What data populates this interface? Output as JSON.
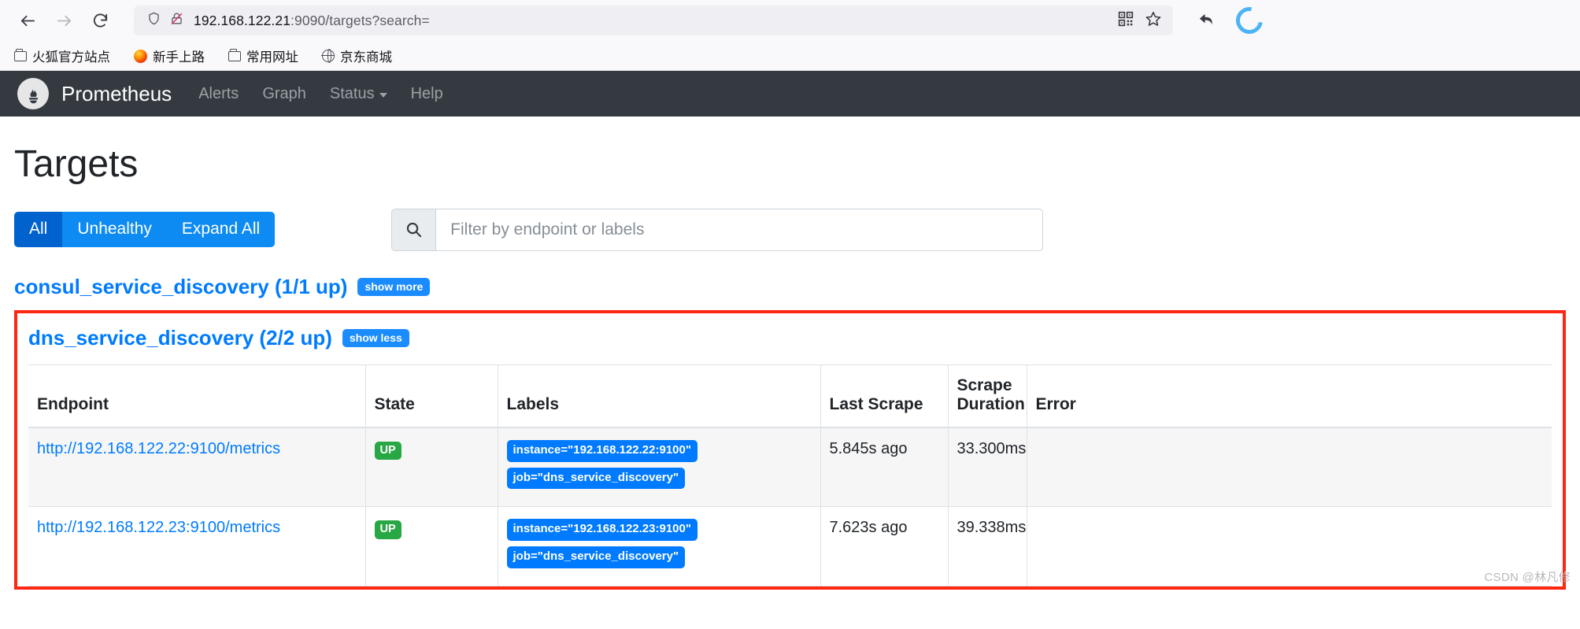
{
  "browser": {
    "back_label": "back-arrow",
    "forward_label": "forward-arrow",
    "reload_label": "reload",
    "url_host": "192.168.122.21",
    "url_rest": ":9090/targets?search=",
    "url_full": "192.168.122.21:9090/targets?search=",
    "shield_icon": "shield-icon",
    "permissions_icon": "no-lock-icon",
    "qr_icon": "qr-code-icon",
    "bookmark_icon": "star-icon",
    "undo_icon": "undo-arrow-icon",
    "sync_icon": "sync-circle-icon",
    "bookmarks": [
      {
        "label": "火狐官方站点",
        "icon": "folder-icon"
      },
      {
        "label": "新手上路",
        "icon": "firefox-icon"
      },
      {
        "label": "常用网址",
        "icon": "folder-icon"
      },
      {
        "label": "京东商城",
        "icon": "globe-icon"
      }
    ]
  },
  "navbar": {
    "logo_icon": "prometheus-torch-icon",
    "brand": "Prometheus",
    "links": [
      {
        "label": "Alerts",
        "dropdown": false
      },
      {
        "label": "Graph",
        "dropdown": false
      },
      {
        "label": "Status",
        "dropdown": true
      },
      {
        "label": "Help",
        "dropdown": false
      }
    ]
  },
  "page": {
    "title": "Targets",
    "filter_buttons": [
      {
        "label": "All",
        "active": true
      },
      {
        "label": "Unhealthy",
        "active": false
      },
      {
        "label": "Expand All",
        "active": false
      }
    ],
    "search": {
      "icon": "search-icon",
      "value": "",
      "placeholder": "Filter by endpoint or labels"
    },
    "watermark": "CSDN @林凡修"
  },
  "pools": [
    {
      "title": "consul_service_discovery (1/1 up)",
      "toggle_label": "show more",
      "expanded": false,
      "highlighted": false
    },
    {
      "title": "dns_service_discovery (2/2 up)",
      "toggle_label": "show less",
      "expanded": true,
      "highlighted": true,
      "highlight_color": "#fe2712",
      "columns": [
        "Endpoint",
        "State",
        "Labels",
        "Last Scrape",
        "Scrape Duration",
        "Error"
      ],
      "rows": [
        {
          "endpoint": "http://192.168.122.22:9100/metrics",
          "state": "UP",
          "labels": [
            "instance=\"192.168.122.22:9100\"",
            "job=\"dns_service_discovery\""
          ],
          "last_scrape": "5.845s ago",
          "scrape_duration": "33.300ms",
          "error": ""
        },
        {
          "endpoint": "http://192.168.122.23:9100/metrics",
          "state": "UP",
          "labels": [
            "instance=\"192.168.122.23:9100\"",
            "job=\"dns_service_discovery\""
          ],
          "last_scrape": "7.623s ago",
          "scrape_duration": "39.338ms",
          "error": ""
        }
      ]
    }
  ]
}
